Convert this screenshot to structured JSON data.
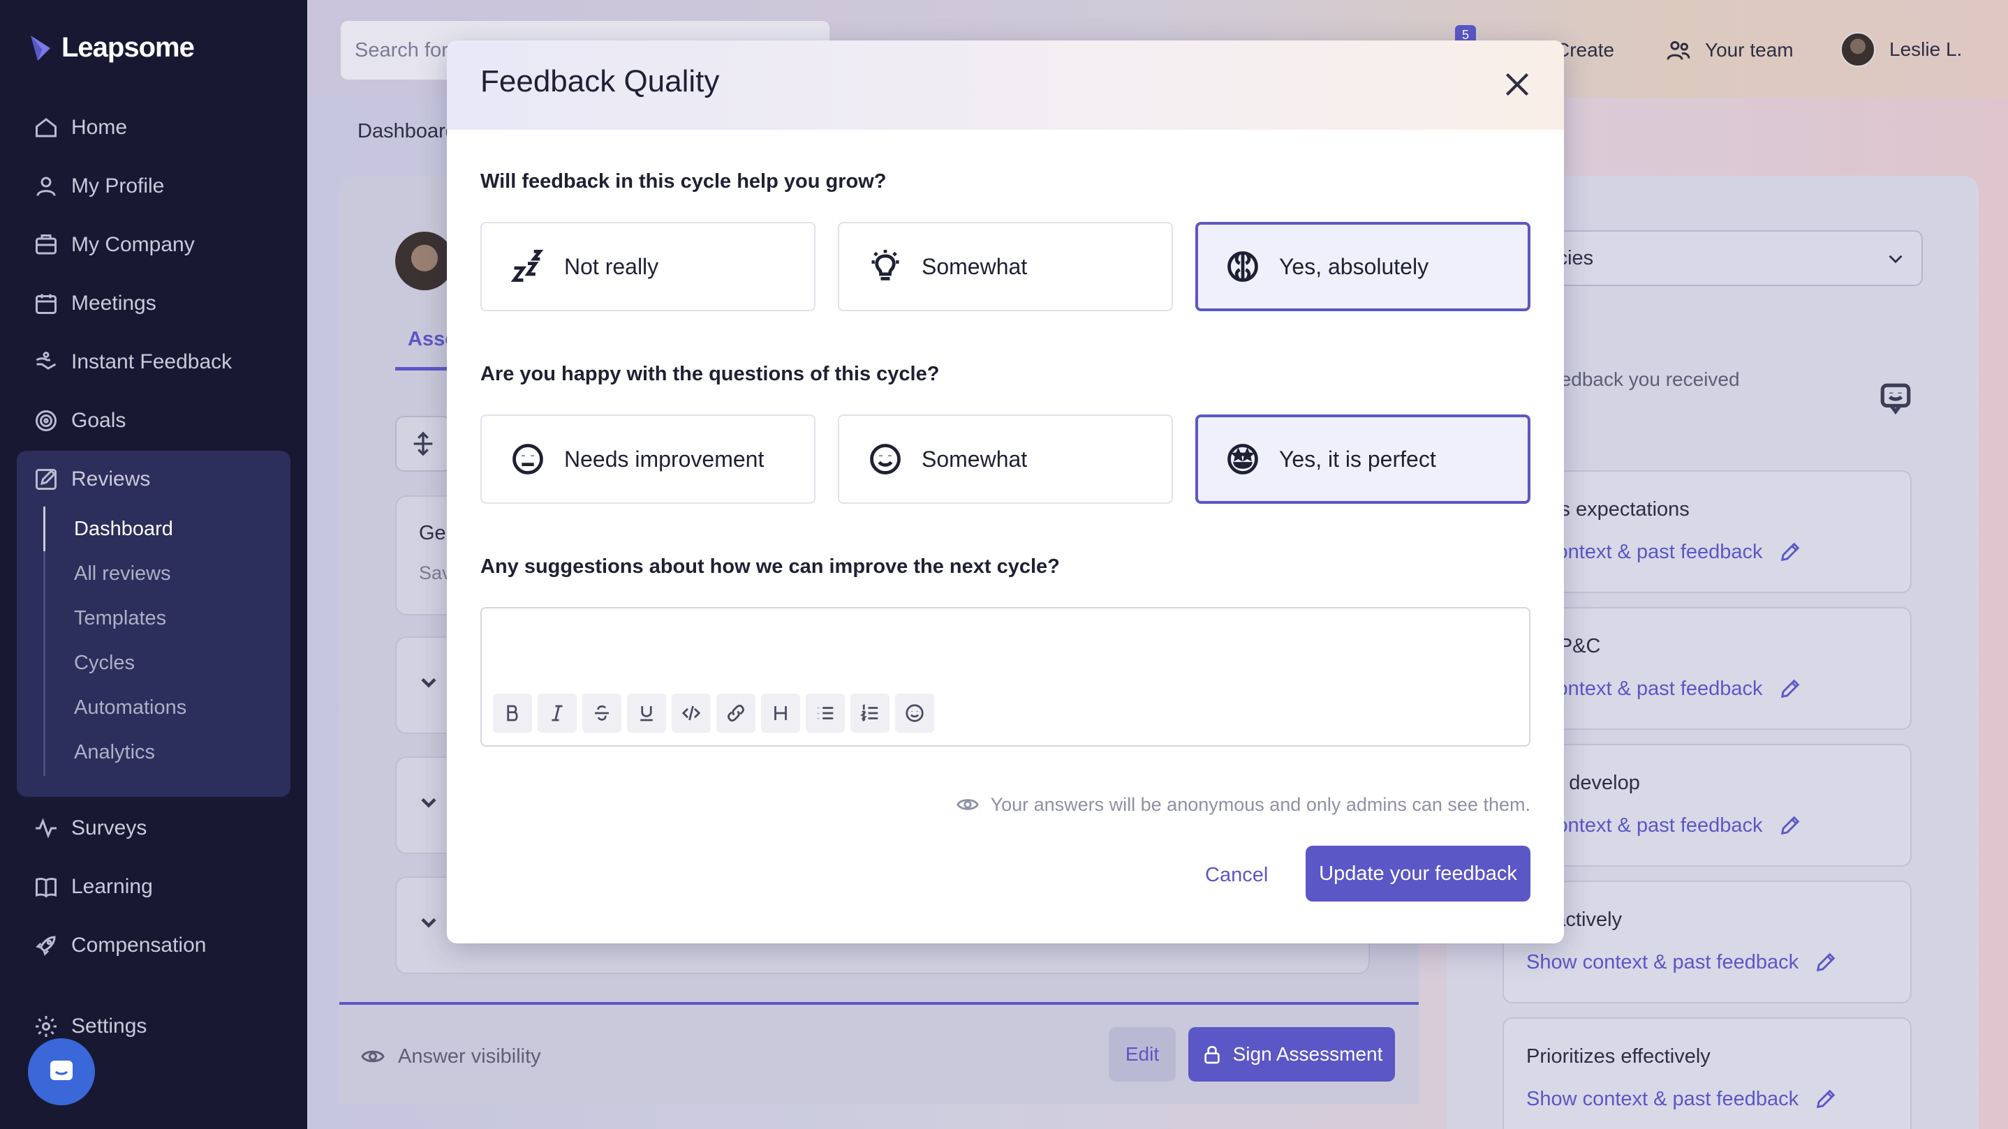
{
  "app": {
    "name": "Leapsome"
  },
  "sidebar": {
    "items": [
      {
        "label": "Home",
        "icon": "home-icon"
      },
      {
        "label": "My Profile",
        "icon": "user-icon"
      },
      {
        "label": "My Company",
        "icon": "building-icon"
      },
      {
        "label": "Meetings",
        "icon": "calendar-icon"
      },
      {
        "label": "Instant Feedback",
        "icon": "hand-icon"
      },
      {
        "label": "Goals",
        "icon": "target-icon"
      },
      {
        "label": "Reviews",
        "icon": "edit-icon"
      },
      {
        "label": "Surveys",
        "icon": "pulse-icon"
      },
      {
        "label": "Learning",
        "icon": "book-icon"
      },
      {
        "label": "Compensation",
        "icon": "rocket-icon"
      },
      {
        "label": "Settings",
        "icon": "gear-icon"
      }
    ],
    "review_subitems": [
      "Dashboard",
      "All reviews",
      "Templates",
      "Cycles",
      "Automations",
      "Analytics"
    ]
  },
  "header": {
    "search_placeholder": "Search for",
    "notification_count": "5",
    "create_label": "Create",
    "team_label": "Your team",
    "user_name": "Leslie L."
  },
  "background": {
    "breadcrumb": "Dashboard",
    "tab_label": "Asse",
    "card_title": "Ge",
    "card_subtitle": "Sav",
    "answer_visibility": "Answer visibility",
    "edit_label": "Edit",
    "sign_label": "Sign Assessment",
    "select_value": "petencies",
    "feedback_prompt_1": "e feedback you received",
    "feedback_prompt_2": "?",
    "competencies": [
      {
        "title": "ages expectations",
        "link": "w context & past feedback"
      },
      {
        "title": "ing P&C",
        "link": "w context & past feedback"
      },
      {
        "title": "rn & develop",
        "link": "w context & past feedback"
      },
      {
        "title": "en actively",
        "link": "Show context & past feedback"
      },
      {
        "title": "Prioritizes effectively",
        "link": "Show context & past feedback"
      }
    ]
  },
  "modal": {
    "title": "Feedback Quality",
    "q1": "Will feedback in this cycle help you grow?",
    "q1_options": [
      {
        "label": "Not really",
        "icon": "sleep-icon",
        "selected": false
      },
      {
        "label": "Somewhat",
        "icon": "lightbulb-icon",
        "selected": false
      },
      {
        "label": "Yes, absolutely",
        "icon": "brain-icon",
        "selected": true
      }
    ],
    "q2": "Are you happy with the questions of this cycle?",
    "q2_options": [
      {
        "label": "Needs improvement",
        "icon": "neutral-face-icon",
        "selected": false
      },
      {
        "label": "Somewhat",
        "icon": "smile-face-icon",
        "selected": false
      },
      {
        "label": "Yes, it is perfect",
        "icon": "star-eyes-face-icon",
        "selected": true
      }
    ],
    "q3": "Any suggestions about how we can improve the next cycle?",
    "suggestion_value": "",
    "toolbar": [
      "B",
      "I",
      "S",
      "U",
      "code",
      "link",
      "H",
      "bullets",
      "numbers",
      "emoji"
    ],
    "anon_note": "Your answers will be anonymous and only admins can see them.",
    "cancel_label": "Cancel",
    "submit_label": "Update your feedback"
  },
  "colors": {
    "accent": "#5b57c6",
    "sidebar_bg": "#181833"
  }
}
